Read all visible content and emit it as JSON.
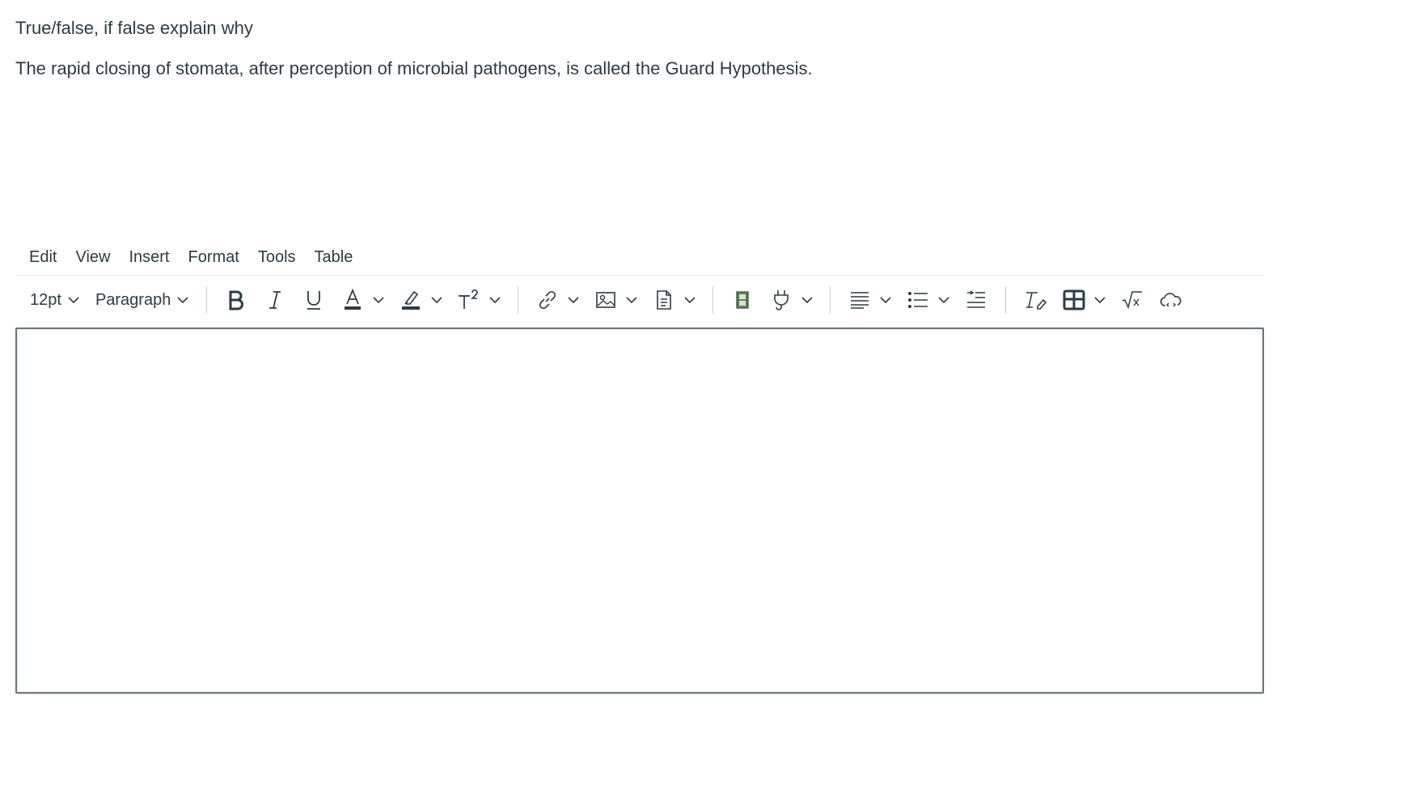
{
  "question": {
    "instruction": "True/false, if false explain why",
    "statement": "The rapid closing of stomata, after perception of microbial pathogens, is called the Guard Hypothesis."
  },
  "menubar": {
    "items": [
      "Edit",
      "View",
      "Insert",
      "Format",
      "Tools",
      "Table"
    ]
  },
  "toolbar": {
    "font_size": "12pt",
    "block_format": "Paragraph",
    "superscript_label": "T²",
    "icons": [
      "bold-icon",
      "italic-icon",
      "underline-icon",
      "text-color-icon",
      "highlight-icon",
      "superscript-icon",
      "link-icon",
      "image-icon",
      "document-icon",
      "media-icon",
      "plugin-icon",
      "align-icon",
      "bullet-list-icon",
      "indent-icon",
      "clear-format-icon",
      "table-icon",
      "math-equation-icon",
      "cloud-icon"
    ]
  },
  "colors": {
    "text": "#2d3b45",
    "border": "#6b7780",
    "separator": "#c7cdd1"
  }
}
